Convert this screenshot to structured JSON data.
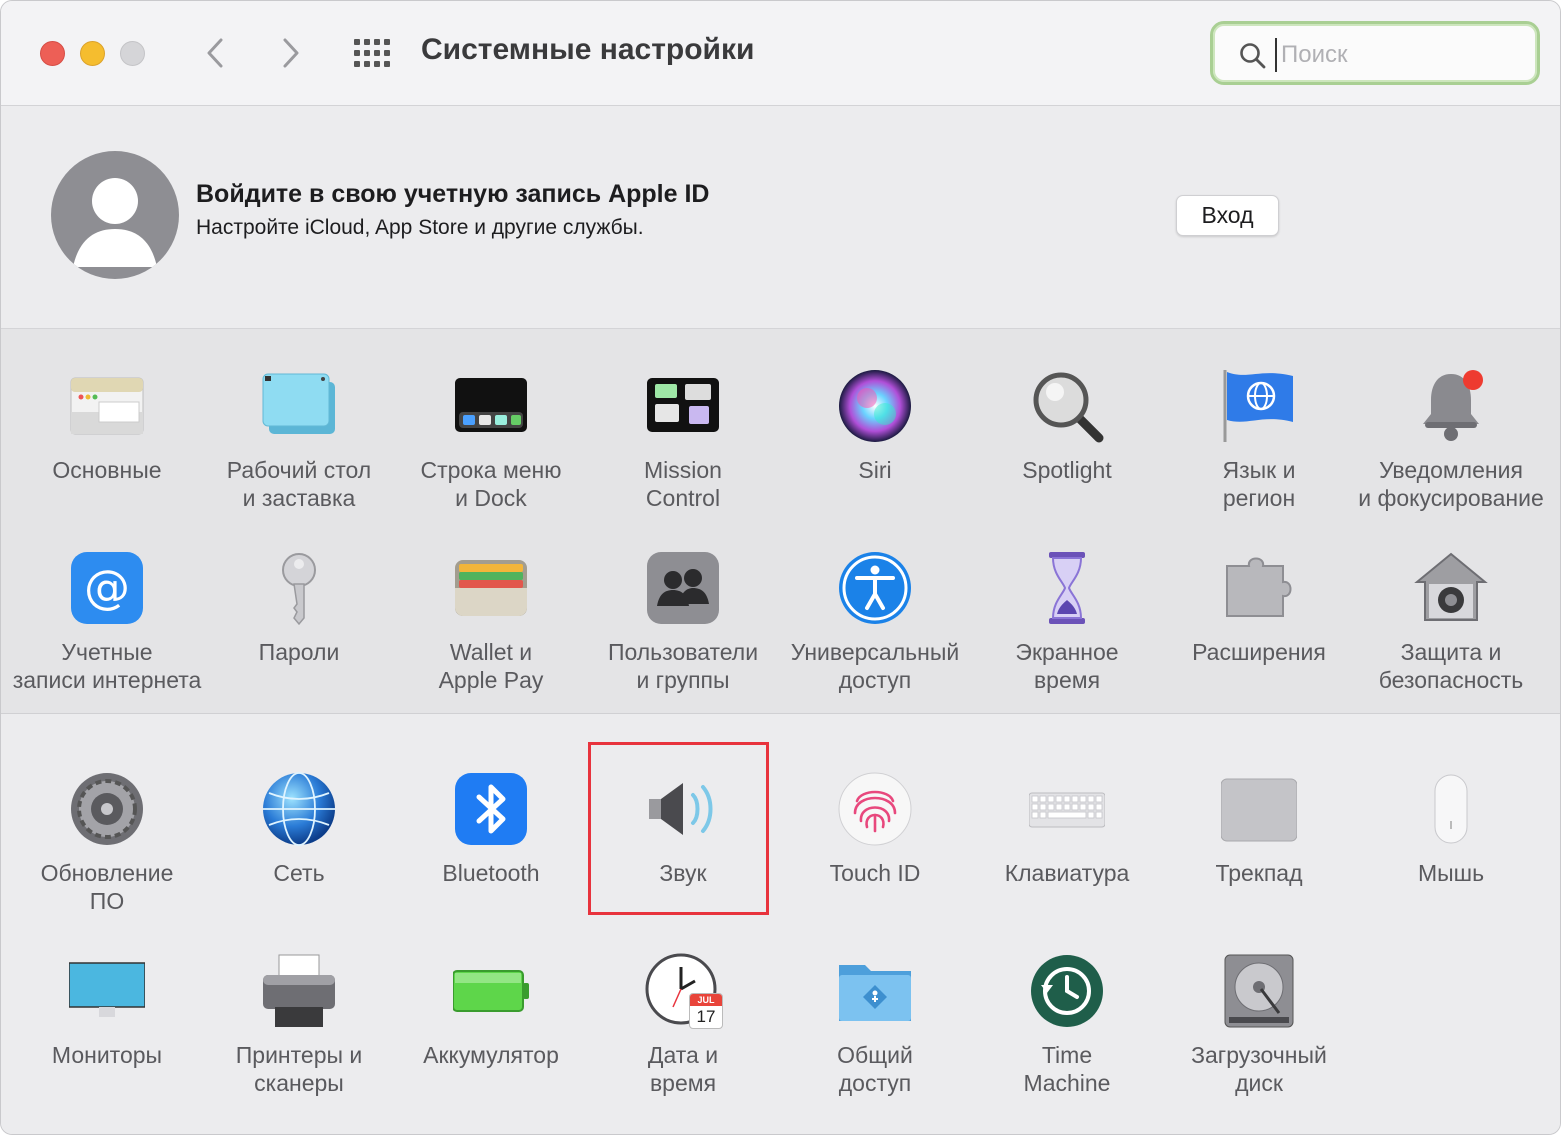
{
  "window": {
    "title": "Системные настройки",
    "search": {
      "placeholder": "Поиск",
      "value": ""
    }
  },
  "account": {
    "title": "Войдите в свою учетную запись Apple ID",
    "subtitle": "Настройте iCloud, App Store и другие службы.",
    "login_label": "Вход"
  },
  "panes": [
    {
      "label": "Основные",
      "icon": "general-icon"
    },
    {
      "label": "Рабочий стол\nи заставка",
      "icon": "desktop-icon"
    },
    {
      "label": "Строка меню\nи Dock",
      "icon": "dock-icon"
    },
    {
      "label": "Mission\nControl",
      "icon": "mission-control-icon"
    },
    {
      "label": "Siri",
      "icon": "siri-icon"
    },
    {
      "label": "Spotlight",
      "icon": "spotlight-icon"
    },
    {
      "label": "Язык и\nрегион",
      "icon": "language-flag-icon"
    },
    {
      "label": "Уведомления\nи фокусирование",
      "icon": "notifications-bell-icon"
    },
    {
      "label": "Учетные\nзаписи интернета",
      "icon": "internet-accounts-icon"
    },
    {
      "label": "Пароли",
      "icon": "key-icon"
    },
    {
      "label": "Wallet и\nApple Pay",
      "icon": "wallet-icon"
    },
    {
      "label": "Пользователи\nи группы",
      "icon": "users-icon"
    },
    {
      "label": "Универсальный\nдоступ",
      "icon": "accessibility-icon"
    },
    {
      "label": "Экранное\nвремя",
      "icon": "hourglass-icon"
    },
    {
      "label": "Расширения",
      "icon": "puzzle-icon"
    },
    {
      "label": "Защита и\nбезопасность",
      "icon": "house-lock-icon"
    },
    {
      "label": "Обновление\nПО",
      "icon": "gear-icon"
    },
    {
      "label": "Сеть",
      "icon": "globe-network-icon"
    },
    {
      "label": "Bluetooth",
      "icon": "bluetooth-icon"
    },
    {
      "label": "Звук",
      "icon": "speaker-icon"
    },
    {
      "label": "Touch ID",
      "icon": "fingerprint-icon"
    },
    {
      "label": "Клавиатура",
      "icon": "keyboard-icon"
    },
    {
      "label": "Трекпад",
      "icon": "trackpad-icon"
    },
    {
      "label": "Мышь",
      "icon": "mouse-icon"
    },
    {
      "label": "Мониторы",
      "icon": "monitor-icon"
    },
    {
      "label": "Принтеры и\nсканеры",
      "icon": "printer-icon"
    },
    {
      "label": "Аккумулятор",
      "icon": "battery-icon"
    },
    {
      "label": "Дата и\nвремя",
      "icon": "clock-calendar-icon",
      "calendar_month": "JUL",
      "calendar_day": "17"
    },
    {
      "label": "Общий\nдоступ",
      "icon": "sharing-folder-icon"
    },
    {
      "label": "Time\nMachine",
      "icon": "time-machine-icon"
    },
    {
      "label": "Загрузочный\nдиск",
      "icon": "hard-disk-icon"
    }
  ],
  "colors": {
    "search_focus": "#a9cf93",
    "highlight": "#e8333d",
    "close": "#ed5f56",
    "minimize": "#f5bd2f"
  }
}
